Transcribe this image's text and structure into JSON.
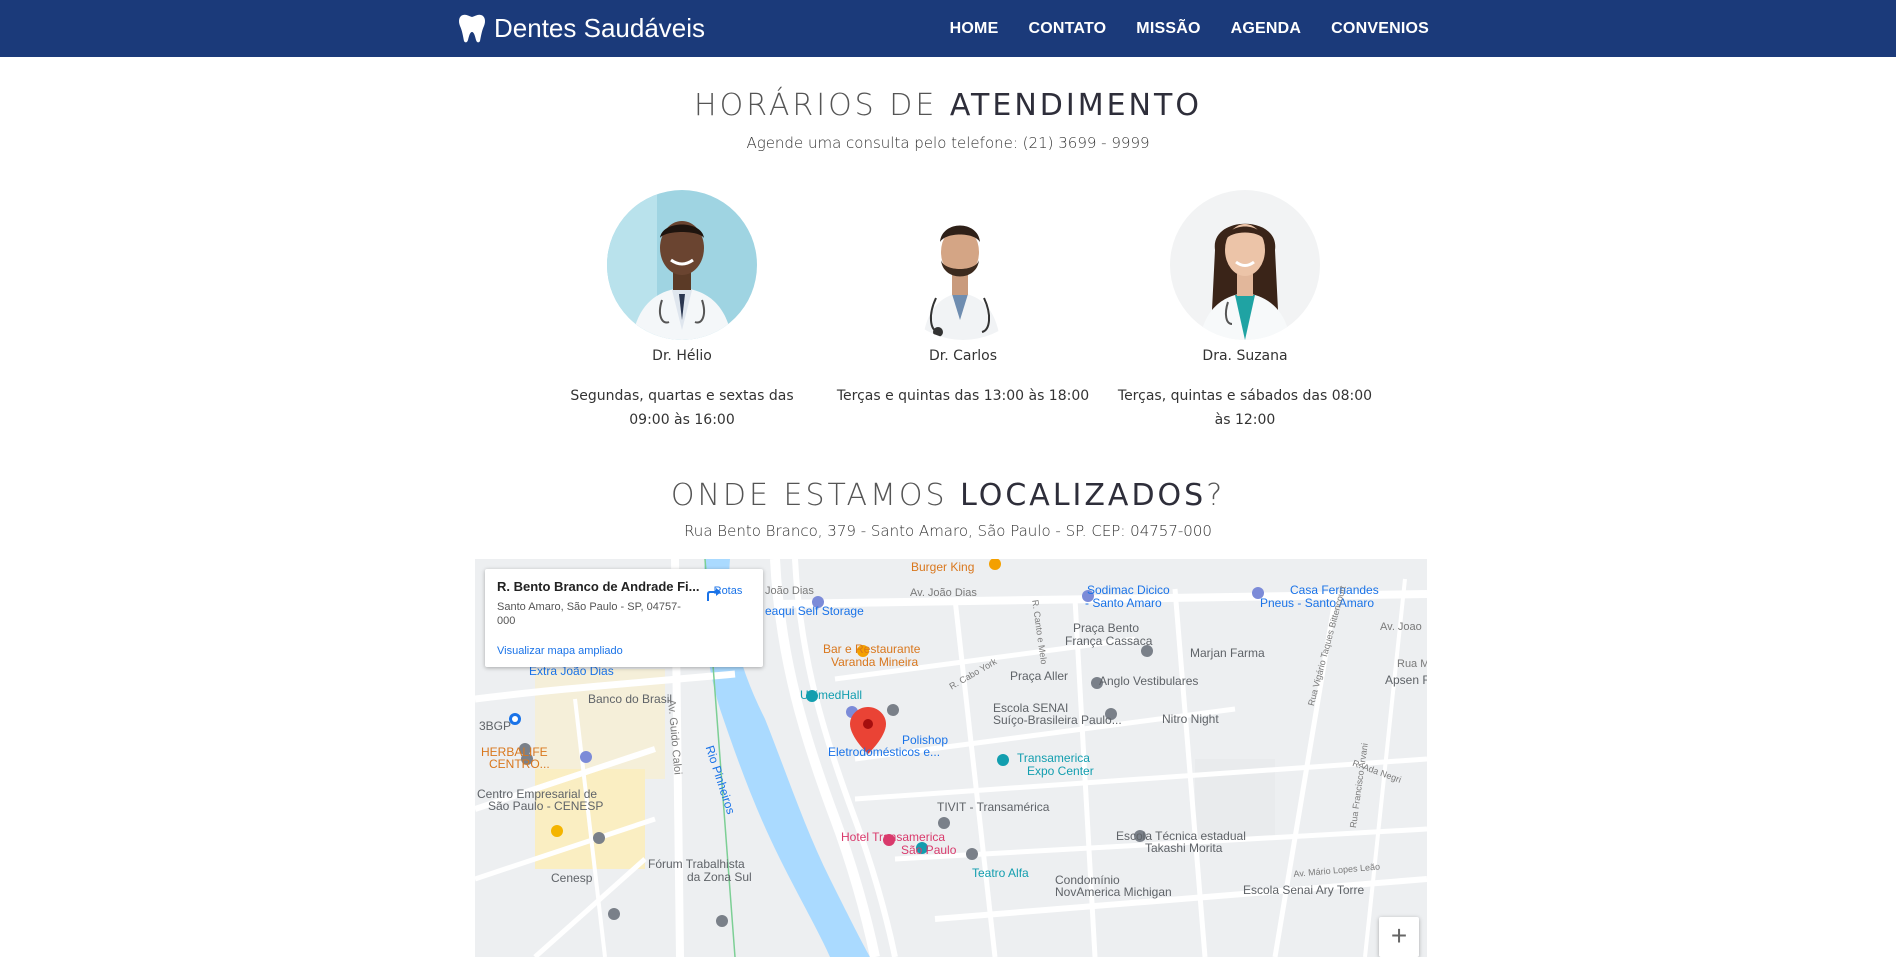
{
  "navbar": {
    "brand": "Dentes Saudáveis",
    "brand_icon": "tooth-icon",
    "links": [
      "HOME",
      "CONTATO",
      "MISSÃO",
      "AGENDA",
      "CONVENIOS"
    ],
    "background": "#1b3a7a"
  },
  "schedule": {
    "title_light": "HORÁRIOS DE ",
    "title_bold": "ATENDIMENTO",
    "subtitle": "Agende uma consulta pelo telefone: (21) 3699 - 9999",
    "doctors": [
      {
        "name": "Dr. Hélio",
        "hours": "Segundas, quartas e sextas das 09:00 às 16:00"
      },
      {
        "name": "Dr. Carlos",
        "hours": "Terças e quintas das 13:00 às 18:00"
      },
      {
        "name": "Dra. Suzana",
        "hours": "Terças, quintas e sábados das 08:00 às 12:00"
      }
    ]
  },
  "location": {
    "title_light": "ONDE ESTAMOS ",
    "title_bold": "LOCALIZADOS",
    "title_end": "?",
    "address": "Rua Bento Branco, 379 - Santo Amaro, São Paulo - SP. CEP: 04757-000"
  },
  "map": {
    "card_title": "R. Bento Branco de Andrade Fi...",
    "card_address": "Santo Amaro, São Paulo - SP, 04757-000",
    "card_link": "Visualizar mapa ampliado",
    "directions_label": "Rotas",
    "zoom_in": "+",
    "labels": {
      "burger_king": "Burger King",
      "joao_dias_top": "João Dias",
      "av_joao_dias": "Av. João Dias",
      "sodimac1": "Sodimac Dicico",
      "sodimac2": "- Santo Amaro",
      "casa1": "Casa Fernandes",
      "casa2": "Pneus - Santo Amaro",
      "av_right": "Av. Joao",
      "self_storage": "eaqui Self Storage",
      "praca_bento1": "Praça Bento",
      "praca_bento2": "França Cassaca",
      "bar1": "Bar e Restaurante",
      "bar2": "Varanda Mineira",
      "marjan": "Marjan Farma",
      "rua_ma": "Rua Ma",
      "extra": "Extra João Dias",
      "praca_aller": "Praça Aller",
      "anglo": "Anglo Vestibulares",
      "apsen": "Apsen F",
      "banco": "Banco do Brasil",
      "unimed": "UnimedHall",
      "escola_senai1": "Escola SENAI",
      "escola_senai2": "Suíço-Brasileira Paulo...",
      "nitro": "Nitro Night",
      "bgp": "3BGP",
      "polishop1": "Polishop",
      "polishop2": "Eletrodomésticos e...",
      "herbalife1": "HERBALIFE",
      "herbalife2": "CENTRO...",
      "transamerica1": "Transamerica",
      "transamerica2": "Expo Center",
      "cenesp1": "Centro Empresarial de",
      "cenesp2": "São Paulo - CENESP",
      "tivit": "TIVIT - Transamérica",
      "hotel1": "Hotel Transamerica",
      "hotel2": "São Paulo",
      "escola_tec1": "Escola Técnica estadual",
      "escola_tec2": "Takashi Morita",
      "forum1": "Fórum Trabalhista",
      "forum2": "da Zona Sul",
      "teatro": "Teatro Alfa",
      "condominio1": "Condomínio",
      "condominio2": "NovAmerica Michigan",
      "cenesp_short": "Cenesp",
      "escola_ary": "Escola Senai Ary Torre",
      "rio": "Rio Pinheiros",
      "guido": "Av. Guido Caloi",
      "cabo_york": "R. Cabo York",
      "canto_melo": "R. Canto e Melo",
      "vigario": "Rua Vigário Taques Bittencourt",
      "ada_negri": "R. Ada Negri",
      "francisco_arvani": "Rua Francisco Arvani",
      "mario_lopes": "Av. Mário Lopes Leão"
    }
  }
}
